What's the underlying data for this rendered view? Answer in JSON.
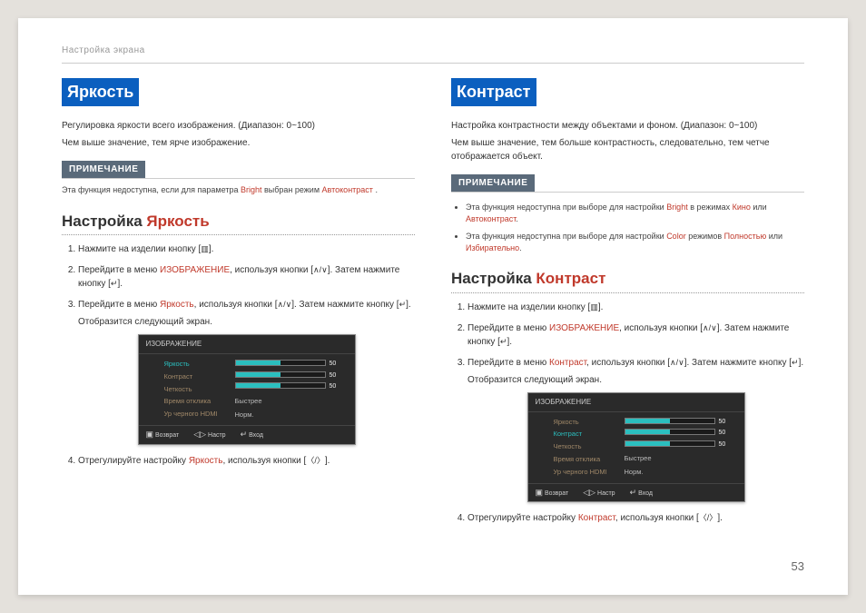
{
  "header": "Настройка экрана",
  "pageNumber": "53",
  "noteLabel": "ПРИМЕЧАНИЕ",
  "left": {
    "title": "Яркость",
    "intro1": "Регулировка яркости всего изображения. (Диапазон: 0~100)",
    "intro2": "Чем выше значение, тем ярче изображение.",
    "note_p1": "Эта функция недоступна, если для параметра ",
    "note_hl1": "Bright",
    "note_p2": " выбран режим ",
    "note_hl2": "Автоконтраст",
    "note_p3": ".",
    "subTitle_a": "Настройка ",
    "subTitle_b": "Яркость",
    "s1a": "Нажмите на изделии кнопку [",
    "s1b": "].",
    "s2a": "Перейдите в меню ",
    "s2hl": "ИЗОБРАЖЕНИЕ",
    "s2b": ", используя кнопки [",
    "s2c": "]. Затем нажмите кнопку [",
    "s2d": "].",
    "s3a": "Перейдите в меню ",
    "s3hl": "Яркость",
    "s3b": ", используя кнопки [",
    "s3c": "]. Затем нажмите кнопку [",
    "s3d": "].",
    "s3e": "Отобразится следующий экран.",
    "s4a": "Отрегулируйте настройку ",
    "s4hl": "Яркость",
    "s4b": ", используя кнопки [",
    "s4c": "]."
  },
  "right": {
    "title": "Контраст",
    "intro1": "Настройка контрастности между объектами и фоном. (Диапазон: 0~100)",
    "intro2": "Чем выше значение, тем больше контрастность, следовательно, тем четче отображается объект.",
    "b1a": "Эта функция недоступна при выборе для настройки ",
    "b1hl1": "Bright",
    "b1b": " в режимах ",
    "b1hl2": "Кино",
    "b1c": " или ",
    "b1hl3": "Автоконтраст",
    "b1d": ".",
    "b2a": "Эта функция недоступна при выборе для настройки ",
    "b2hl1": "Color",
    "b2b": " режимов ",
    "b2hl2": "Полностью",
    "b2c": " или ",
    "b2hl3": "Избирательно",
    "b2d": ".",
    "subTitle_a": "Настройка ",
    "subTitle_b": "Контраст",
    "s1a": "Нажмите на изделии кнопку [",
    "s1b": "].",
    "s2a": "Перейдите в меню ",
    "s2hl": "ИЗОБРАЖЕНИЕ",
    "s2b": ", используя кнопки [",
    "s2c": "]. Затем нажмите кнопку [",
    "s2d": "].",
    "s3a": "Перейдите в меню ",
    "s3hl": "Контраст",
    "s3b": ", используя кнопки [",
    "s3c": "]. Затем нажмите кнопку [",
    "s3d": "].",
    "s3e": "Отобразится следующий экран.",
    "s4a": "Отрегулируйте настройку ",
    "s4hl": "Контраст",
    "s4b": ", используя кнопки [",
    "s4c": "]."
  },
  "osd": {
    "title": "ИЗОБРАЖЕНИЕ",
    "items": [
      "Яркость",
      "Контраст",
      "Четкость",
      "Время отклика",
      "Ур черного HDMI"
    ],
    "val50": "50",
    "resp": "Быстрее",
    "hdmi": "Норм.",
    "f1": "Возврат",
    "f2": "Настр",
    "f3": "Вход"
  },
  "icons": {
    "menu": "▥",
    "updown": "∧/∨",
    "enter": "↵",
    "leftright": "〈/〉",
    "ret": "▣",
    "adj": "◁▷",
    "ent": "↵"
  }
}
